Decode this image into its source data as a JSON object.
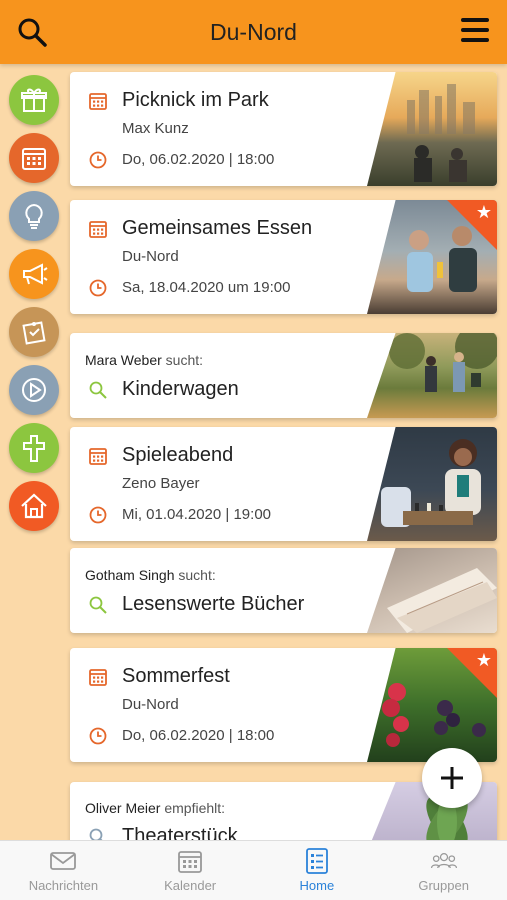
{
  "header": {
    "title": "Du-Nord"
  },
  "colors": {
    "accent": "#f7941d",
    "active_tab": "#2b82d9",
    "event_icon": "#e5672b",
    "search_icon": "#8cc63f",
    "ribbon": "#f15a24"
  },
  "sidebar": {
    "items": [
      {
        "name": "gift-icon",
        "color": "#8cc63f"
      },
      {
        "name": "calendar-icon",
        "color": "#e5672b"
      },
      {
        "name": "lightbulb-icon",
        "color": "#8aa0b4"
      },
      {
        "name": "megaphone-icon",
        "color": "#f7941d"
      },
      {
        "name": "note-icon",
        "color": "#c69557"
      },
      {
        "name": "play-icon",
        "color": "#8aa0b4"
      },
      {
        "name": "cross-icon",
        "color": "#8cc63f"
      },
      {
        "name": "home-icon",
        "color": "#f15a24"
      }
    ]
  },
  "feed": {
    "card1": {
      "title": "Picknick im Park",
      "sub": "Max Kunz",
      "date": "Do, 06.02.2020 | 18:00"
    },
    "card2": {
      "title": "Gemeinsames Essen",
      "sub": "Du-Nord",
      "date": "Sa, 18.04.2020 um 19:00"
    },
    "card3": {
      "who": "Mara Weber",
      "verb": "sucht:",
      "title": "Kinderwagen"
    },
    "card4": {
      "title": "Spieleabend",
      "sub": "Zeno Bayer",
      "date": "Mi, 01.04.2020 | 19:00"
    },
    "card5": {
      "who": "Gotham Singh",
      "verb": "sucht:",
      "title": "Lesenswerte Bücher"
    },
    "card6": {
      "title": "Sommerfest",
      "sub": "Du-Nord",
      "date": "Do, 06.02.2020 | 18:00"
    },
    "card7": {
      "who": "Oliver Meier",
      "verb": "empfiehlt:",
      "title": "Theaterstück"
    }
  },
  "tabs": {
    "nachrichten": "Nachrichten",
    "kalender": "Kalender",
    "home": "Home",
    "gruppen": "Gruppen"
  }
}
